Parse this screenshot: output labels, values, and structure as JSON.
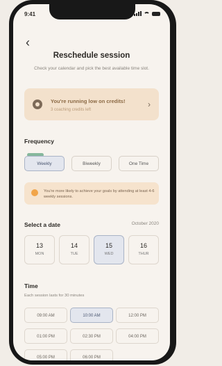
{
  "status": {
    "time": "9:41"
  },
  "header": {
    "title": "Reschedule session",
    "subtitle": "Check your calendar and pick the best available time slot."
  },
  "credits": {
    "title": "You're running low on credits!",
    "subtitle": "3 coaching credits left"
  },
  "frequency": {
    "label": "Frequency",
    "options": [
      "Weekly",
      "Biweekly",
      "One Time"
    ],
    "selected": "Weekly",
    "tip": "You're more likely to achieve your goals by attending at least 4-6 weekly sessions."
  },
  "date": {
    "label": "Select a date",
    "month": "October 2020",
    "days": [
      {
        "num": "13",
        "wk": "MON"
      },
      {
        "num": "14",
        "wk": "TUE"
      },
      {
        "num": "15",
        "wk": "WED"
      },
      {
        "num": "16",
        "wk": "THUR"
      }
    ],
    "selected": "15"
  },
  "time": {
    "label": "Time",
    "hint": "Each session lasts for 30 minutes",
    "slots": [
      "09:00 AM",
      "10:00 AM",
      "12:00 PM",
      "01:00 PM",
      "02:30 PM",
      "04:00 PM",
      "05:00 PM",
      "06:00 PM"
    ],
    "selected": "10:00 AM"
  },
  "colors": {
    "accent": "#e3e6ee",
    "warning": "#f3e1cc",
    "recommended": "#86b79c"
  }
}
